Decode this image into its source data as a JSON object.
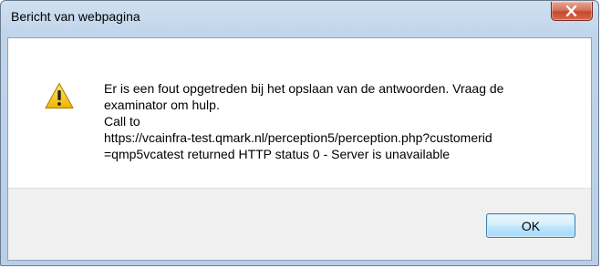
{
  "window": {
    "title": "Bericht van webpagina"
  },
  "dialog": {
    "message_lines": [
      "Er is een fout opgetreden bij het opslaan van de antwoorden. Vraag de",
      "examinator om hulp.",
      "Call to",
      "https://vcainfra-test.qmark.nl/perception5/perception.php?customerid",
      "=qmp5vcatest returned HTTP status 0 - Server is unavailable"
    ],
    "ok_label": "OK",
    "icon": "warning-icon"
  },
  "colors": {
    "frame": "#b9cfe6",
    "close_button": "#c4482e",
    "warning_yellow": "#f5c400",
    "footer": "#f0f0f0"
  }
}
